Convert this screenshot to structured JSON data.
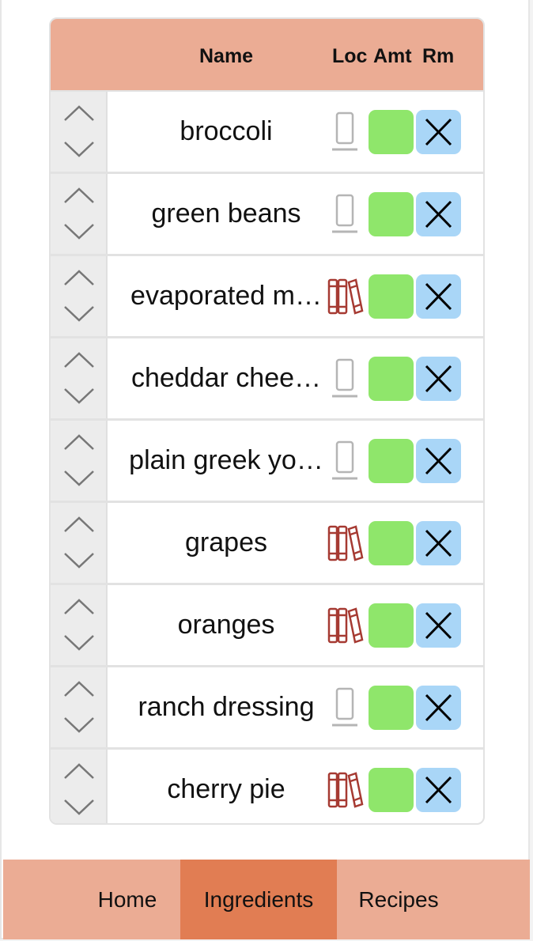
{
  "header": {
    "name": "Name",
    "loc": "Loc",
    "amt": "Amt",
    "rm": "Rm"
  },
  "rows": [
    {
      "name": "broccoli",
      "loc": "fridge"
    },
    {
      "name": "green beans",
      "loc": "fridge"
    },
    {
      "name": "evaporated m…",
      "loc": "pantry"
    },
    {
      "name": "cheddar chee…",
      "loc": "fridge"
    },
    {
      "name": "plain greek yo…",
      "loc": "fridge"
    },
    {
      "name": "grapes",
      "loc": "pantry"
    },
    {
      "name": "oranges",
      "loc": "pantry"
    },
    {
      "name": "ranch dressing",
      "loc": "fridge"
    },
    {
      "name": "cherry pie",
      "loc": "pantry"
    }
  ],
  "icons": {
    "fridge": "fridge-icon",
    "pantry": "books-icon",
    "move_up": "chevron-up-icon",
    "move_down": "chevron-down-icon",
    "remove": "close-icon"
  },
  "colors": {
    "header_bg": "#ebac94",
    "nav_active": "#e17d53",
    "amount_button": "#8fe66b",
    "remove_button": "#a9d6f7",
    "pantry_icon": "#a63a32"
  },
  "nav": {
    "home": "Home",
    "ingredients": "Ingredients",
    "recipes": "Recipes",
    "active": "Ingredients"
  }
}
